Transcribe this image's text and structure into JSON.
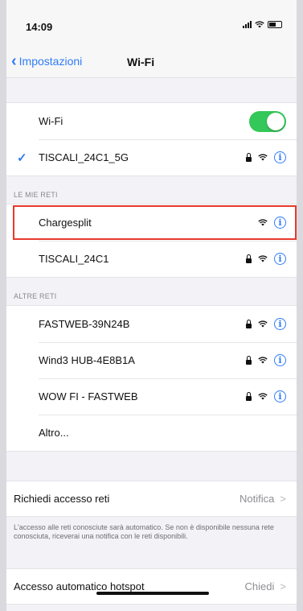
{
  "status_bar": {
    "time": "14:09"
  },
  "nav": {
    "back_label": "Impostazioni",
    "title": "Wi-Fi"
  },
  "wifi_group": {
    "toggle_label": "Wi-Fi",
    "toggle_on": true,
    "connected_network": "TISCALI_24C1_5G"
  },
  "my_networks": {
    "header": "LE MIE RETI",
    "items": [
      {
        "name": "Chargesplit",
        "locked": false,
        "highlighted": true
      },
      {
        "name": "TISCALI_24C1",
        "locked": true,
        "highlighted": false
      }
    ]
  },
  "other_networks": {
    "header": "ALTRE RETI",
    "items": [
      {
        "name": "FASTWEB-39N24B",
        "locked": true
      },
      {
        "name": "Wind3 HUB-4E8B1A",
        "locked": true
      },
      {
        "name": "WOW FI - FASTWEB",
        "locked": true
      }
    ],
    "other_label": "Altro..."
  },
  "ask_to_join": {
    "label": "Richiedi accesso reti",
    "value": "Notifica"
  },
  "footnote": "L'accesso alle reti conosciute sarà automatico. Se non è disponibile nessuna rete conosciuta, riceverai una notifica con le reti disponibili.",
  "auto_join_hotspot": {
    "label": "Accesso automatico hotspot",
    "value": "Chiedi"
  },
  "colors": {
    "accent": "#2f7cf6",
    "toggle_green": "#34c759",
    "highlight_red": "#e8392c"
  },
  "icons": [
    "back-chevron-icon",
    "lock-icon",
    "wifi-icon",
    "info-icon",
    "checkmark-icon",
    "chevron-right-icon"
  ]
}
